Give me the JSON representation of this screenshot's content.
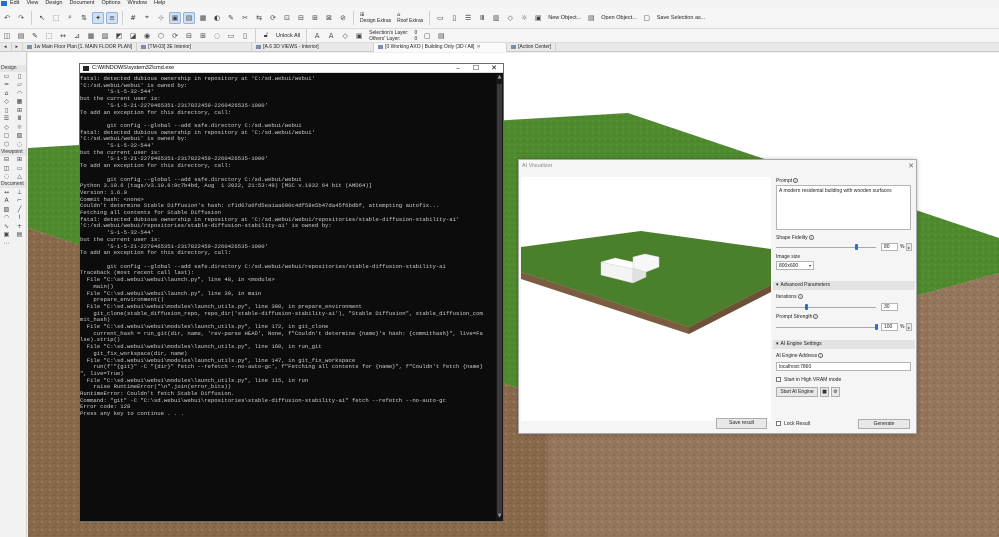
{
  "menu": [
    "Edit",
    "View",
    "Design",
    "Document",
    "Options",
    "Window",
    "Help"
  ],
  "toolbar": {
    "design_extras": "Design Extras",
    "roof_extras": "Roof Extras",
    "new_object": "New Object...",
    "open_object": "Open Object...",
    "save_selection": "Save Selection as...",
    "unlock_all": "Unlock All",
    "selections_layer_line1": "Selection's Layer:",
    "selections_layer_line2": "Others' Layer:",
    "layer_value_1": "0",
    "layer_value_2": "0"
  },
  "tabs": [
    {
      "label": "1w Main Floor Plan [1. MAIN FLOOR PLAN]"
    },
    {
      "label": "[TM-03] 3E Interior]"
    },
    {
      "label": "[A.6 3D VIEWS - Interior]"
    },
    {
      "label": "[0 Working AXO | Building Only (3D / All]"
    },
    {
      "label": "[Action Center]"
    }
  ],
  "toolbox": {
    "design_header": "Design",
    "viewpoint_header": "Viewpoint",
    "document_header": "Document"
  },
  "cmd": {
    "title": "C:\\WINDOWS\\system32\\cmd.exe",
    "lines": [
      "fatal: detected dubious ownership in repository at 'C:/sd.webui/webui'",
      "'C:/sd.webui/webui' is owned by:",
      "        'S-1-5-32-544'",
      "but the current user is:",
      "        'S-1-5-21-2279465351-2317822459-2260426535-1000'",
      "To add an exception for this directory, call:",
      "",
      "        git config --global --add safe.directory C:/sd.webui/webui",
      "fatal: detected dubious ownership in repository at 'C:/sd.webui/webui'",
      "'C:/sd.webui/webui' is owned by:",
      "        'S-1-5-32-544'",
      "but the current user is:",
      "        'S-1-5-21-2279465351-2317822459-2260426535-1000'",
      "To add an exception for this directory, call:",
      "",
      "        git config --global --add safe.directory C:/sd.webui/webui",
      "Python 3.10.6 (tags/v3.10.6:9c7b4bd, Aug  1 2022, 21:53:49) [MSC v.1932 64 bit (AMD64)]",
      "Version: 1.6.0",
      "Commit hash: <none>",
      "Couldn't determine Stable Diffusion's hash: cf1d67a6fd5ea1aa600c4df58e5b47da45f6bdbf, attempting autofix...",
      "Fetching all contents for Stable Diffusion",
      "fatal: detected dubious ownership in repository at 'C:/sd.webui/webui/repositories/stable-diffusion-stability-ai'",
      "'C:/sd.webui/webui/repositories/stable-diffusion-stability-ai' is owned by:",
      "        'S-1-5-32-544'",
      "but the current user is:",
      "        'S-1-5-21-2279465351-2317822459-2260426535-1000'",
      "To add an exception for this directory, call:",
      "",
      "        git config --global --add safe.directory C:/sd.webui/webui/repositories/stable-diffusion-stability-ai",
      "Traceback (most recent call last):",
      "  File \"C:\\sd.webui\\webui\\launch.py\", line 48, in <module>",
      "    main()",
      "  File \"C:\\sd.webui\\webui\\launch.py\", line 39, in main",
      "    prepare_environment()",
      "  File \"C:\\sd.webui\\webui\\modules\\launch_utils.py\", line 380, in prepare_environment",
      "    git_clone(stable_diffusion_repo, repo_dir('stable-diffusion-stability-ai'), \"Stable Diffusion\", stable_diffusion_com",
      "mit_hash)",
      "  File \"C:\\sd.webui\\webui\\modules\\launch_utils.py\", line 172, in git_clone",
      "    current_hash = run_git(dir, name, 'rev-parse HEAD', None, f\"Couldn't determine {name}'s hash: {commithash}\", live=Fa",
      "lse).strip()",
      "  File \"C:\\sd.webui\\webui\\modules\\launch_utils.py\", line 160, in run_git",
      "    git_fix_workspace(dir, name)",
      "  File \"C:\\sd.webui\\webui\\modules\\launch_utils.py\", line 147, in git_fix_workspace",
      "    run(f'\"{git}\" -C \"{dir}\" fetch --refetch --no-auto-gc', f\"Fetching all contents for {name}\", f\"Couldn't fetch {name}",
      "\", live=True)",
      "  File \"C:\\sd.webui\\webui\\modules\\launch_utils.py\", line 115, in run",
      "    raise RuntimeError(\"\\n\".join(error_bits))",
      "RuntimeError: Couldn't fetch Stable Diffusion.",
      "Command: \"git\" -C \"C:\\sd.webui\\webui\\repositories\\stable-diffusion-stability-ai\" fetch --refetch --no-auto-gc",
      "Error code: 128",
      "Press any key to continue . . ."
    ]
  },
  "ai": {
    "title": "AI Visualizer",
    "prompt_label": "Prompt",
    "prompt_text": "A modern residental building with wooden surfaces",
    "shape_fidelity_label": "Shape Fidelity",
    "shape_fidelity_value": "80",
    "shape_fidelity_level": 0.8,
    "percent": "%",
    "image_size_label": "Image size",
    "image_size_value": "800x600",
    "advanced_label": "Advanced Parameters",
    "iterations_label": "Iterations",
    "iterations_value": "30",
    "iterations_level": 0.3,
    "prompt_strength_label": "Prompt Strength",
    "prompt_strength_value": "100",
    "prompt_strength_level": 1.0,
    "engine_settings_label": "AI Engine Settings",
    "engine_address_label": "AI Engine Address",
    "engine_address_value": "localhost:7860",
    "high_vram_label": "Start in High VRAM mode",
    "start_engine_label": "Start AI Engine",
    "lock_result_label": "Lock Result",
    "generate_label": "Generate",
    "save_result_label": "Save result"
  },
  "colors": {
    "grass": "#4f8a2e",
    "soil": "#8a6a4d",
    "cmd_bg": "#0c0c0c",
    "cmd_text": "#cccccc",
    "accent": "#2d6fd0"
  }
}
